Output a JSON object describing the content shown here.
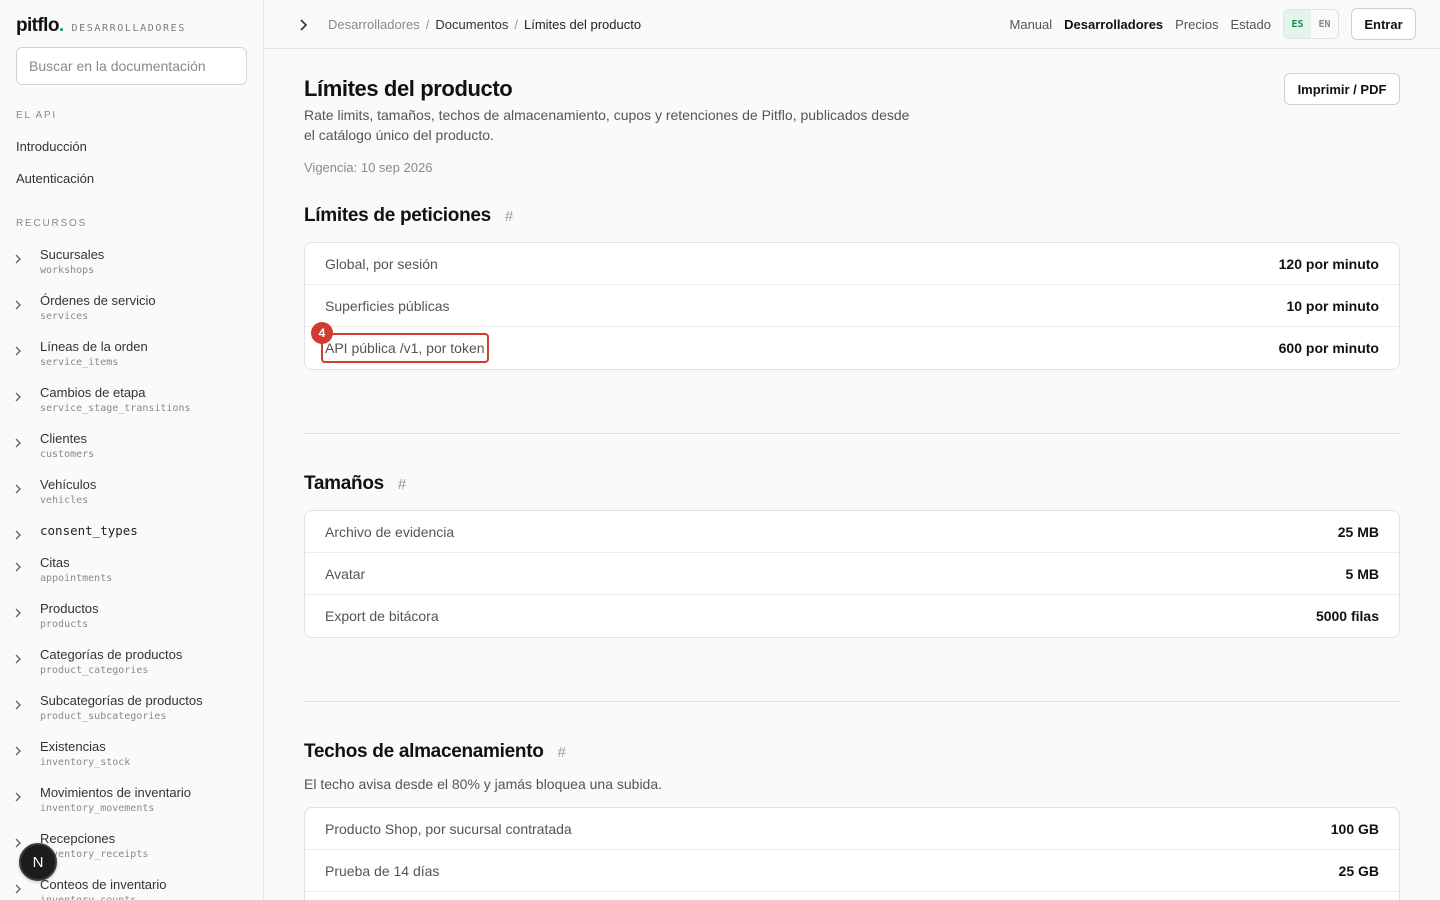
{
  "brand": {
    "name": "pitflo",
    "dot": ".",
    "tag": "DESARROLLADORES"
  },
  "search": {
    "placeholder": "Buscar en la documentación"
  },
  "sidebar": {
    "api_title": "EL API",
    "api_links": [
      "Introducción",
      "Autenticación"
    ],
    "resources_title": "RECURSOS",
    "resources": [
      {
        "label": "Sucursales",
        "code": "workshops"
      },
      {
        "label": "Órdenes de servicio",
        "code": "services"
      },
      {
        "label": "Líneas de la orden",
        "code": "service_items"
      },
      {
        "label": "Cambios de etapa",
        "code": "service_stage_transitions"
      },
      {
        "label": "Clientes",
        "code": "customers"
      },
      {
        "label": "Vehículos",
        "code": "vehicles"
      },
      {
        "label": "consent_types",
        "code": ""
      },
      {
        "label": "Citas",
        "code": "appointments"
      },
      {
        "label": "Productos",
        "code": "products"
      },
      {
        "label": "Categorías de productos",
        "code": "product_categories"
      },
      {
        "label": "Subcategorías de productos",
        "code": "product_subcategories"
      },
      {
        "label": "Existencias",
        "code": "inventory_stock"
      },
      {
        "label": "Movimientos de inventario",
        "code": "inventory_movements"
      },
      {
        "label": "Recepciones",
        "code": "inventory_receipts"
      },
      {
        "label": "Conteos de inventario",
        "code": "inventory_counts"
      }
    ]
  },
  "avatar": {
    "initial": "N"
  },
  "breadcrumb": {
    "root": "Desarrolladores",
    "sep": "/",
    "middle": "Documentos",
    "current": "Límites del producto"
  },
  "topnav": {
    "manual": "Manual",
    "developers": "Desarrolladores",
    "pricing": "Precios",
    "status": "Estado"
  },
  "lang": {
    "es": "ES",
    "en": "EN"
  },
  "login_label": "Entrar",
  "page": {
    "title": "Límites del producto",
    "description": "Rate limits, tamaños, techos de almacenamiento, cupos y retenciones de Pitflo, publicados desde el catálogo único del producto.",
    "effective": "Vigencia: 10 sep 2026",
    "print_label": "Imprimir / PDF"
  },
  "anchor_symbol": "#",
  "sections": {
    "requests": {
      "title": "Límites de peticiones",
      "rows": [
        {
          "k": "Global, por sesión",
          "v": "120 por minuto"
        },
        {
          "k": "Superficies públicas",
          "v": "10 por minuto"
        },
        {
          "k": "API pública /v1, por token",
          "v": "600 por minuto"
        }
      ]
    },
    "sizes": {
      "title": "Tamaños",
      "rows": [
        {
          "k": "Archivo de evidencia",
          "v": "25 MB"
        },
        {
          "k": "Avatar",
          "v": "5 MB"
        },
        {
          "k": "Export de bitácora",
          "v": "5000 filas"
        }
      ]
    },
    "storage": {
      "title": "Techos de almacenamiento",
      "note": "El techo avisa desde el 80% y jamás bloquea una subida.",
      "rows": [
        {
          "k": "Producto Shop, por sucursal contratada",
          "v": "100 GB"
        },
        {
          "k": "Prueba de 14 días",
          "v": "25 GB"
        },
        {
          "k": "",
          "v": ""
        }
      ]
    }
  },
  "highlight": {
    "badge": "4"
  }
}
